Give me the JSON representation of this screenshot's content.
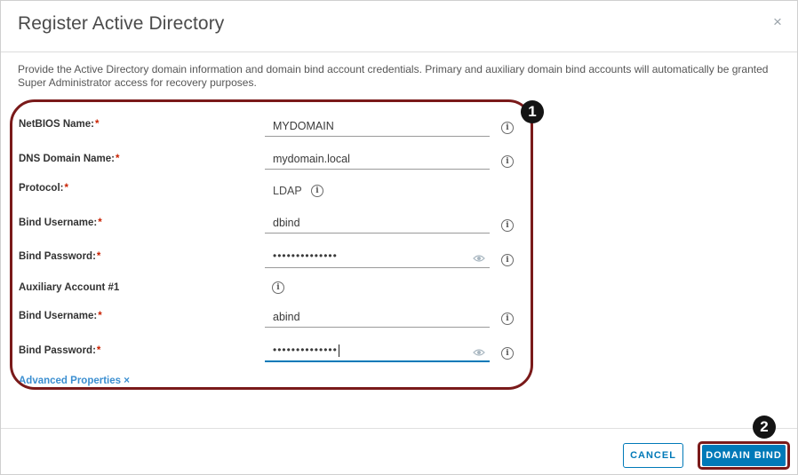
{
  "dialog": {
    "title": "Register Active Directory",
    "close_symbol": "×",
    "description": "Provide the Active Directory domain information and domain bind account credentials. Primary and auxiliary domain bind accounts will automatically be granted Super Administrator access for recovery purposes."
  },
  "form": {
    "required_marker": "*",
    "netbios": {
      "label": "NetBIOS Name:",
      "value": "MYDOMAIN"
    },
    "dns_domain": {
      "label": "DNS Domain Name:",
      "value": "mydomain.local"
    },
    "protocol": {
      "label": "Protocol:",
      "value": "LDAP"
    },
    "bind_username": {
      "label": "Bind Username:",
      "value": "dbind"
    },
    "bind_password": {
      "label": "Bind Password:",
      "value": "••••••••••••••"
    },
    "auxiliary_heading": "Auxiliary Account #1",
    "aux_bind_username": {
      "label": "Bind Username:",
      "value": "abind"
    },
    "aux_bind_password": {
      "label": "Bind Password:",
      "value": "••••••••••••••"
    },
    "advanced_link": "Advanced Properties ×"
  },
  "callouts": {
    "one": "1",
    "two": "2"
  },
  "footer": {
    "cancel_label": "CANCEL",
    "domain_bind_label": "DOMAIN BIND"
  },
  "icons": {
    "info": "info-circle-icon",
    "eye": "eye-icon",
    "close": "close-icon"
  },
  "colors": {
    "accent": "#0079b8",
    "required": "#c92100",
    "highlight": "#7a1a1a"
  }
}
